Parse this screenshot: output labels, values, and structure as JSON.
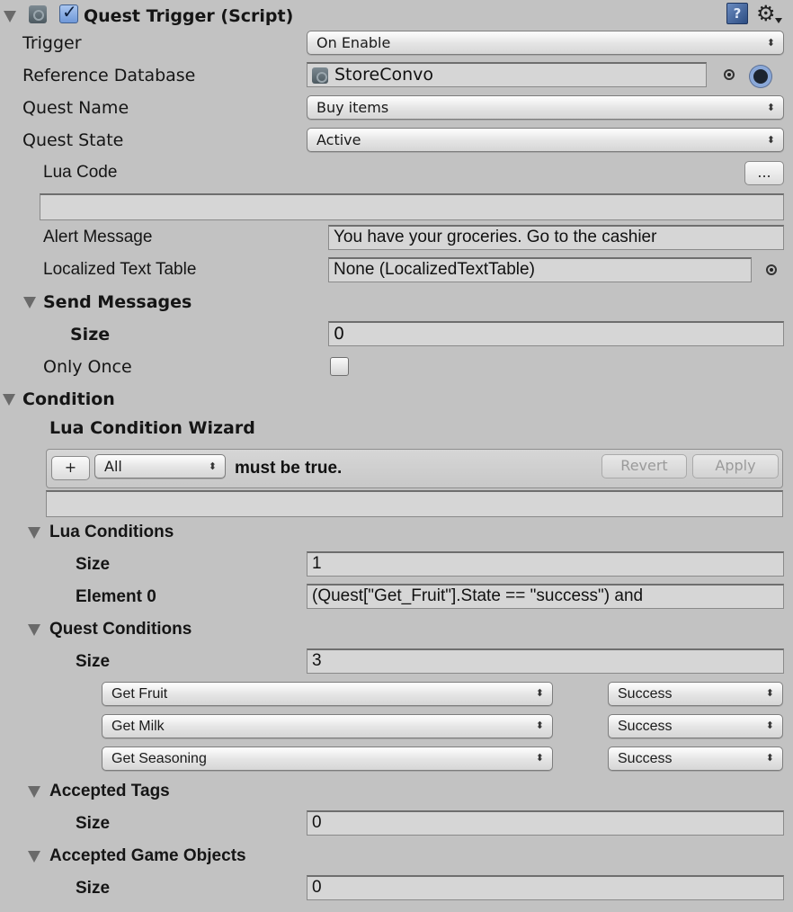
{
  "component": {
    "title": "Quest Trigger (Script)",
    "enabled": true,
    "icons": [
      "unity-script-icon",
      "help-icon",
      "gear-icon"
    ]
  },
  "fields": {
    "trigger": {
      "label": "Trigger",
      "value": "On Enable"
    },
    "reference_database": {
      "label": "Reference Database",
      "value": "StoreConvo"
    },
    "quest_name": {
      "label": "Quest Name",
      "value": "Buy items"
    },
    "quest_state": {
      "label": "Quest State",
      "value": "Active"
    },
    "lua_code": {
      "label": "Lua Code",
      "button": "...",
      "value": ""
    },
    "alert_message": {
      "label": "Alert Message",
      "value": "You have your groceries. Go to the cashier"
    },
    "localized_text_table": {
      "label": "Localized Text Table",
      "value": "None (LocalizedTextTable)"
    },
    "send_messages": {
      "label": "Send Messages",
      "size_label": "Size",
      "size": "0"
    },
    "only_once": {
      "label": "Only Once",
      "checked": false
    }
  },
  "condition": {
    "label": "Condition",
    "wizard": {
      "title": "Lua Condition Wizard",
      "add_button": "+",
      "mode": "All",
      "suffix": "must be true.",
      "revert_button": "Revert",
      "apply_button": "Apply",
      "preview": ""
    },
    "lua_conditions": {
      "label": "Lua Conditions",
      "size_label": "Size",
      "size": "1",
      "element_label": "Element 0",
      "element_value": "(Quest[\"Get_Fruit\"].State == \"success\") and"
    },
    "quest_conditions": {
      "label": "Quest Conditions",
      "size_label": "Size",
      "size": "3",
      "items": [
        {
          "quest": "Get Fruit",
          "state": "Success"
        },
        {
          "quest": "Get Milk",
          "state": "Success"
        },
        {
          "quest": "Get Seasoning",
          "state": "Success"
        }
      ]
    },
    "accepted_tags": {
      "label": "Accepted Tags",
      "size_label": "Size",
      "size": "0"
    },
    "accepted_game_objects": {
      "label": "Accepted Game Objects",
      "size_label": "Size",
      "size": "0"
    }
  }
}
